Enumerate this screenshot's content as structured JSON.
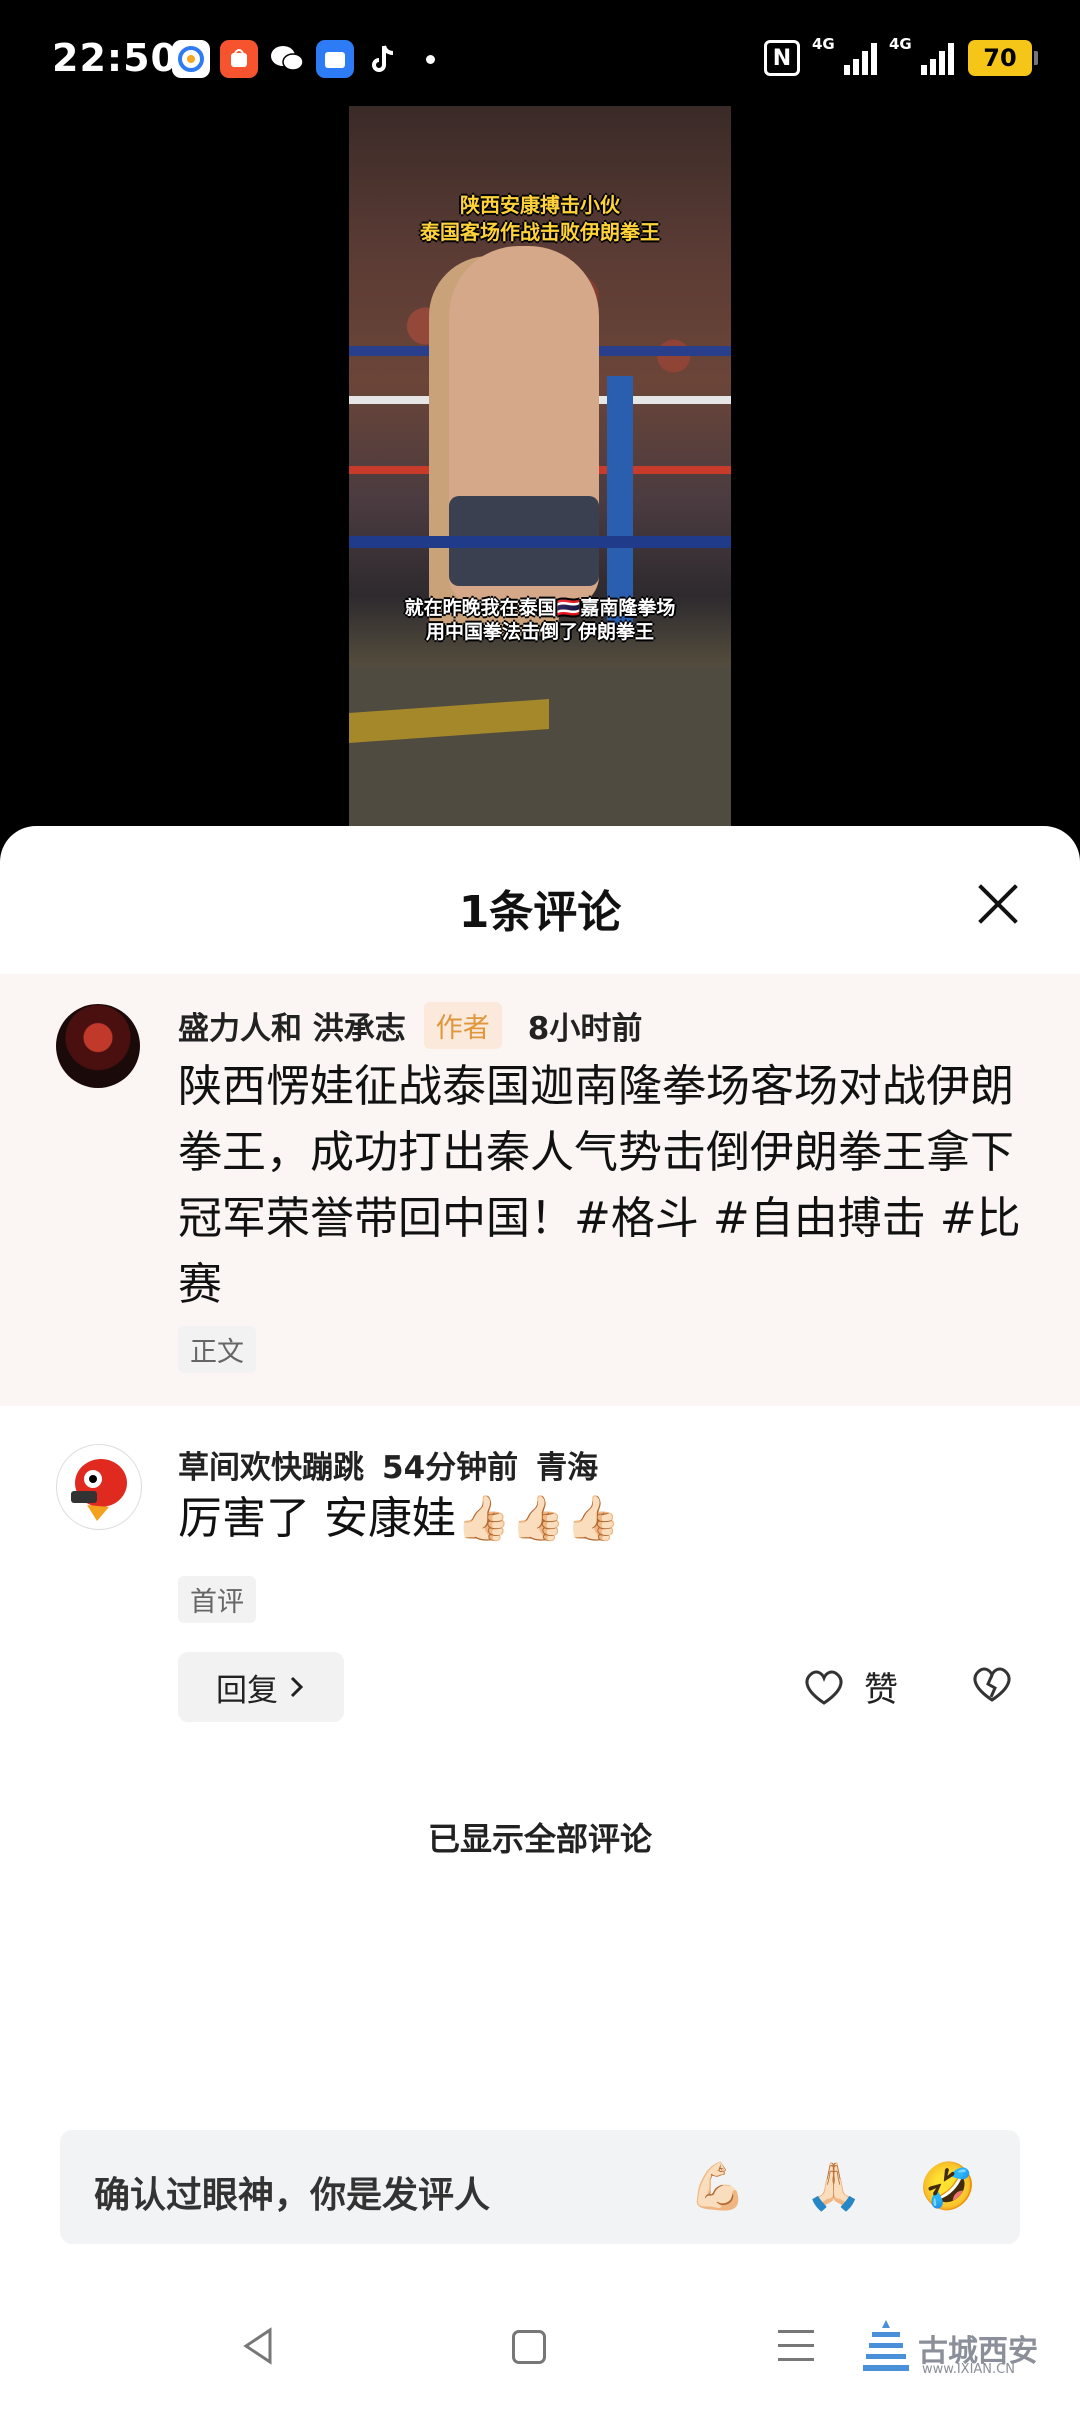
{
  "status_bar": {
    "time": "22:50",
    "signal1": "4G",
    "signal2": "4G",
    "battery": "70"
  },
  "video": {
    "caption_top_1": "陕西安康搏击小伙",
    "caption_top_2": "泰国客场作战击败伊朗拳王",
    "caption_bottom_1": "就在昨晚我在泰国🇹🇭嘉南隆拳场",
    "caption_bottom_2": "用中国拳法击倒了伊朗拳王"
  },
  "sheet": {
    "title": "1条评论"
  },
  "comments": [
    {
      "user": "盛力人和 洪承志",
      "badge": "作者",
      "time": "8小时前",
      "text": "陕西愣娃征战泰国迦南隆拳场客场对战伊朗拳王，成功打出秦人气势击倒伊朗拳王拿下冠军荣誉带回中国！#格斗 #自由搏击 #比赛",
      "tag": "正文"
    },
    {
      "user": "草间欢快蹦跳",
      "time": "54分钟前",
      "location": "青海",
      "text": "厉害了 安康娃👍🏻👍🏻👍🏻",
      "tag": "首评",
      "reply_label": "回复",
      "like_label": "赞"
    }
  ],
  "footer_note": "已显示全部评论",
  "input": {
    "placeholder": "确认过眼神，你是发评人",
    "emojis": [
      "💪🏻",
      "🙏🏻",
      "🤣"
    ]
  },
  "watermark": {
    "text": "古城西安",
    "url": "www.IXIAN.CN"
  }
}
